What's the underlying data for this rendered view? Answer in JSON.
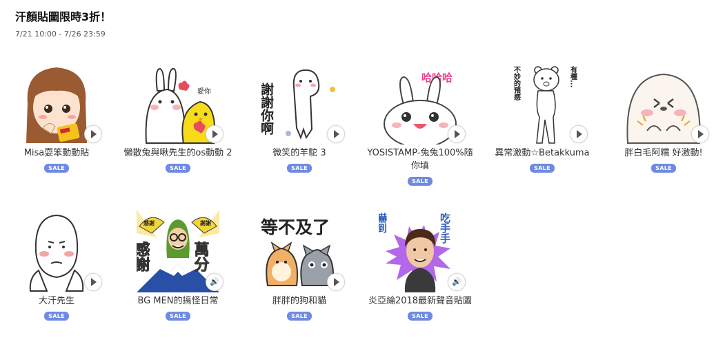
{
  "header": {
    "title": "汗顏貼圖限時3折！",
    "period": "7/21 10:00 - 7/26 23:59"
  },
  "stickers": [
    {
      "name": "Misa耍笨動動貼",
      "badge": "SALE",
      "preview": "play-icon"
    },
    {
      "name": "懶散兔與啾先生的os動動 2",
      "badge": "SALE",
      "preview": "play-icon"
    },
    {
      "name": "微笑的羊駝 3",
      "badge": "SALE",
      "preview": "play-icon"
    },
    {
      "name": "YOSISTAMP-兔兔100%隨你填",
      "badge": "SALE",
      "preview": "play-icon"
    },
    {
      "name": "異常激動☆Betakkuma",
      "badge": "SALE",
      "preview": "play-icon"
    },
    {
      "name": "胖白毛阿糯 好激動!",
      "badge": "SALE",
      "preview": "play-icon"
    },
    {
      "name": "大汗先生",
      "badge": "SALE",
      "preview": "play-icon"
    },
    {
      "name": "BG MEN的搞怪日常",
      "badge": "SALE",
      "preview": "sound-icon"
    },
    {
      "name": "胖胖的狗和貓",
      "badge": "SALE",
      "preview": "play-icon"
    },
    {
      "name": "炎亞綸2018最新聲音貼圖",
      "badge": "SALE",
      "preview": "sound-icon"
    }
  ],
  "art_text": {
    "alpaca": "謝謝你啊",
    "bear_left": "不妙的預感",
    "bear_right": "有種...",
    "rabbit": "哈哈哈",
    "bgmen_left": "感謝",
    "bgmen_right": "萬分",
    "bgmen_fan_left": "感謝",
    "bgmen_fan_right": "謝謝",
    "dogcat": "等不及了",
    "singer_left": "嚇到",
    "singer_right": "吃手手"
  }
}
